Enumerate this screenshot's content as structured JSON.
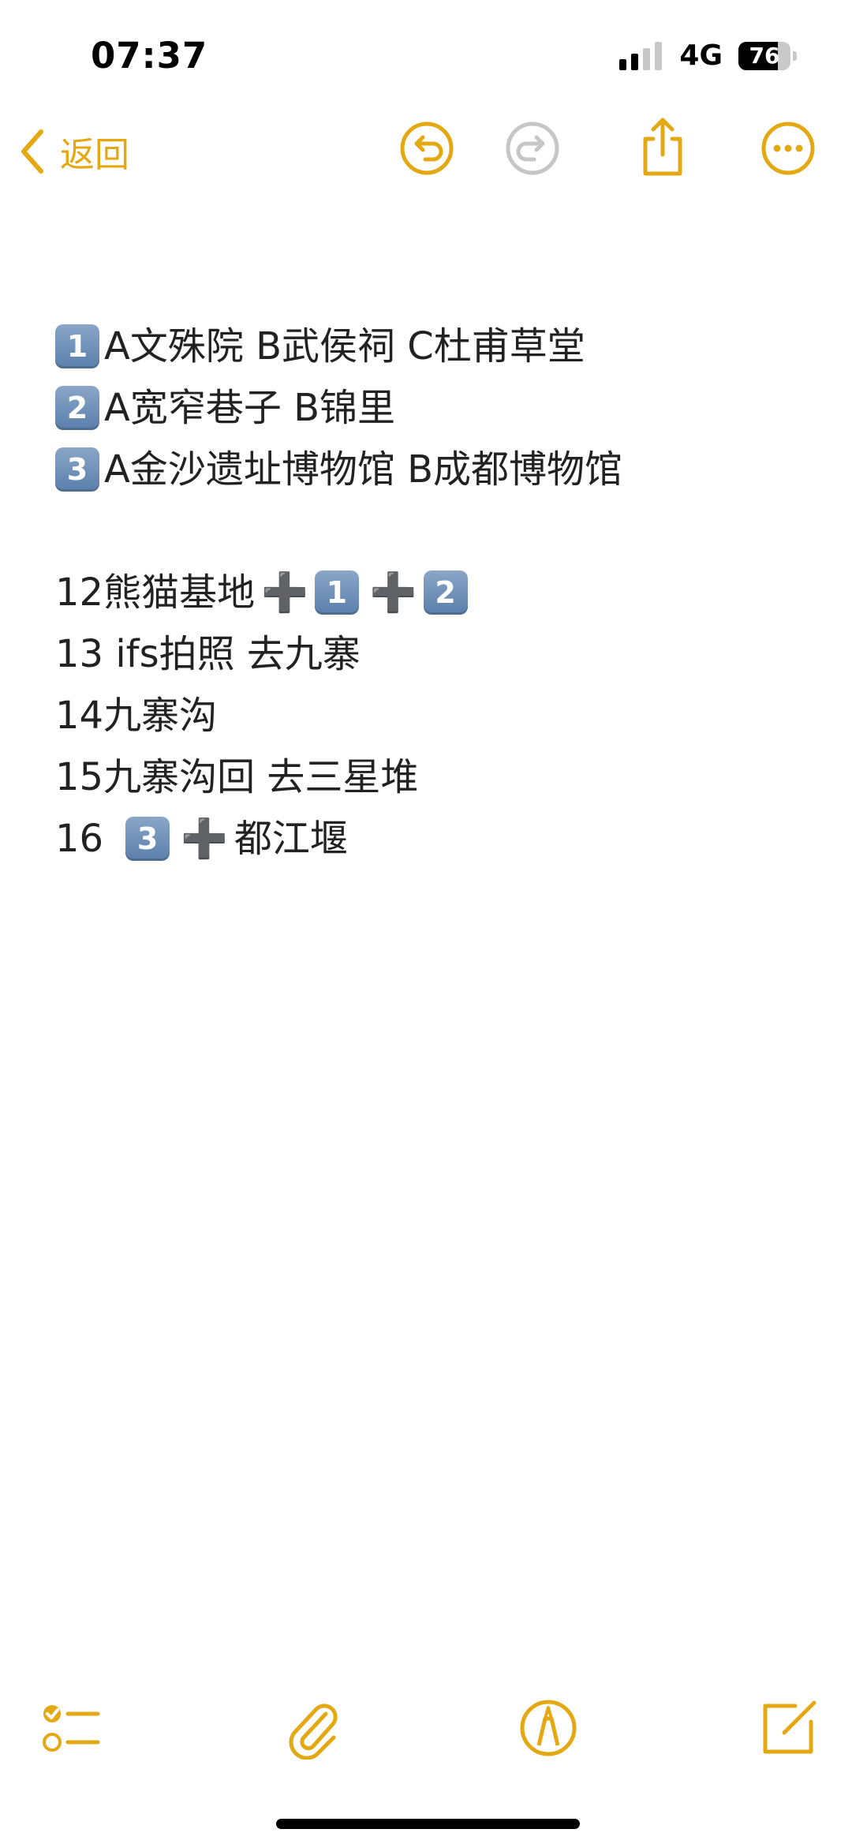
{
  "status_bar": {
    "time": "07:37",
    "network": "4G",
    "battery": "76",
    "battery_level": 0.76
  },
  "nav": {
    "back_label": "返回",
    "icons": [
      "chevron-left-icon",
      "undo-icon",
      "redo-icon",
      "share-icon",
      "more-icon"
    ],
    "accent_color": "#e4a812"
  },
  "note": {
    "lines": [
      {
        "keycap": "1",
        "text": "A文殊院  B武侯祠  C杜甫草堂"
      },
      {
        "keycap": "2",
        "text": "A宽窄巷子  B锦里"
      },
      {
        "keycap": "3",
        "text": "A金沙遗址博物馆  B成都博物馆"
      },
      {
        "prefix": "12熊猫基地",
        "plus": "➕",
        "keycap_a": "1",
        "keycap_b": "2"
      },
      {
        "text": "13 ifs拍照  去九寨"
      },
      {
        "text": "14九寨沟"
      },
      {
        "text": "15九寨沟回  去三星堆"
      },
      {
        "prefix": "16",
        "keycap": "3",
        "plus": "➕",
        "suffix": "都江堰"
      }
    ]
  },
  "bottom_toolbar": {
    "icons": [
      "checklist-icon",
      "paperclip-icon",
      "markup-pen-icon",
      "compose-icon"
    ]
  }
}
